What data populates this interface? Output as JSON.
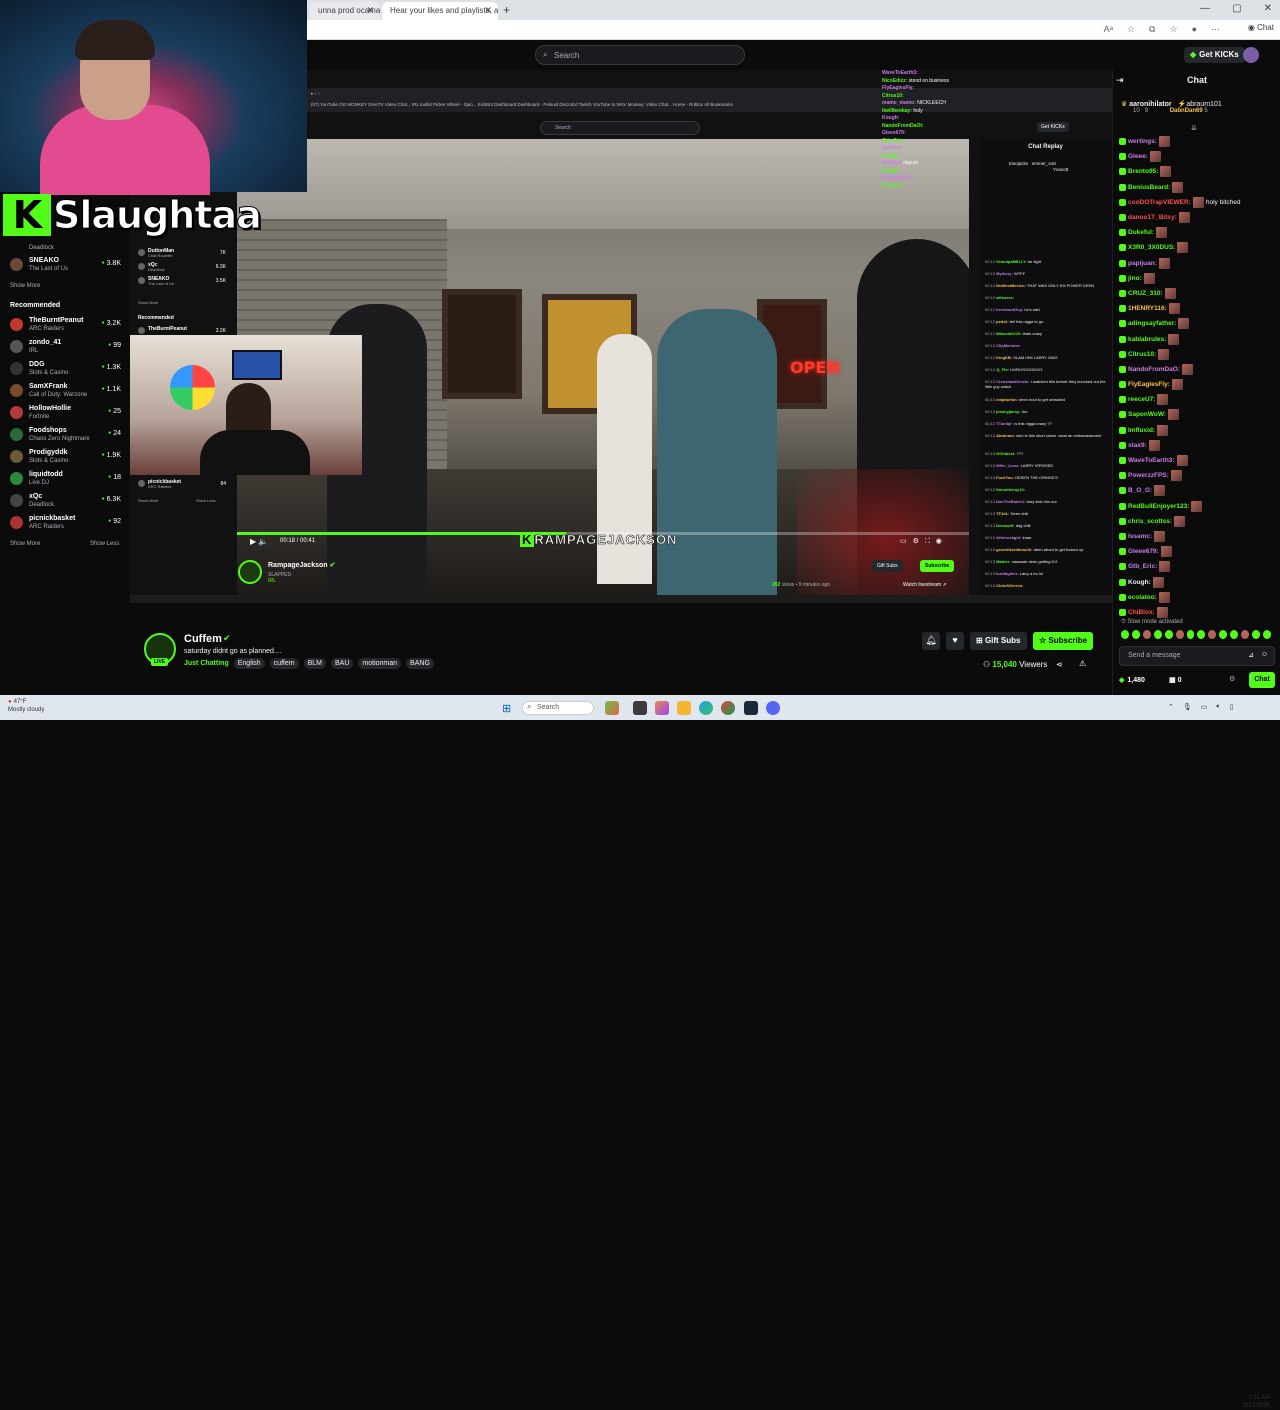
{
  "browser": {
    "tabs": [
      {
        "label": "unna prod ocama.mp",
        "active": false
      },
      {
        "label": "Hear your likes and playlists, and...",
        "active": true
      }
    ],
    "chat_button": "Chat"
  },
  "header": {
    "search_placeholder": "Search",
    "get_kicks": "Get KICKs"
  },
  "streamer_overlay": {
    "name": "Slaughtaa",
    "logo_letter": "K"
  },
  "sidebar": {
    "partial_top": [
      {
        "name": "",
        "category": "Deadlock",
        "viewers": ""
      },
      {
        "name": "SNEAKO",
        "category": "The Last of Us",
        "viewers": "3.8K"
      }
    ],
    "show_more_1": "Show More",
    "recommended_heading": "Recommended",
    "recommended": [
      {
        "name": "TheBurntPeanut",
        "category": "ARC Raiders",
        "viewers": "3.2K"
      },
      {
        "name": "zondo_41",
        "category": "IRL",
        "viewers": "99"
      },
      {
        "name": "DDG",
        "category": "Slots & Casino",
        "viewers": "1.3K"
      },
      {
        "name": "SamXFrank",
        "category": "Call of Duty: Warzone",
        "viewers": "1.1K"
      },
      {
        "name": "HollowHollie",
        "category": "Fortnite",
        "viewers": "25"
      },
      {
        "name": "Foodshops",
        "category": "Chaos Zero Nightmare",
        "viewers": "24"
      },
      {
        "name": "Prodigyddk",
        "category": "Slots & Casino",
        "viewers": "1.9K"
      },
      {
        "name": "liquidtodd",
        "category": "Live DJ",
        "viewers": "18"
      },
      {
        "name": "xQc",
        "category": "Deadlock",
        "viewers": "6.3K"
      },
      {
        "name": "picnickbasket",
        "category": "ARC Raiders",
        "viewers": "92"
      }
    ],
    "show_more_2": "Show More",
    "show_less": "Show Less"
  },
  "nested": {
    "search_placeholder": "Search",
    "get_kicks": "Get KICKs",
    "bookmarks": "(57) YouTube   OG MONKEY   OmeTV Video Chat...   IRL toolkit   Picker Wheel - Spin...   KickBot Dashboard   Dashboard - Pulsoid   DiscroEd   Twitch   YouTube to WAV   Monkey: Video Chat...   Home - Roblox   All Bookmarks",
    "sidebar": [
      {
        "name": "DuttonMan",
        "category": "Chat Roulette",
        "viewers": "7K"
      },
      {
        "name": "xQc",
        "category": "Deadlock",
        "viewers": "6.3K"
      },
      {
        "name": "SNEAKO",
        "category": "The Last of Us",
        "viewers": "3.5K"
      }
    ],
    "sidebar_show_more": "Show More",
    "sidebar_recommended": "Recommended",
    "sidebar_burnt": "TheBurntPeanut",
    "sidebar_burnt_v": "3.2K",
    "sidebar_picnick": "picnickbasket",
    "sidebar_picnick_cat": "ARC Raiders",
    "sidebar_picnick_v": "84",
    "sidebar_show_more_2": "Show More",
    "sidebar_show_less": "Show Less",
    "video": {
      "time": "00:18 / 00:41",
      "progress": 0.45,
      "watermark_k": "K",
      "watermark_text": "RAMPAGEJACKSON",
      "neon_sign": "OPEN"
    },
    "channel": {
      "name": "RampageJackson",
      "title": "SLAPPED",
      "category": "IRL",
      "views": "202",
      "views_suffix": "views • 9 minutes ago",
      "gift_subs": "Gift Subs",
      "subscribe": "Subscribe",
      "watch_livestream": "Watch livestream"
    },
    "chat_replay_title": "Chat Replay",
    "chat_replay_top": [
      {
        "user": "Ewojacks",
        "text": ""
      },
      {
        "user": "emmer_4o8",
        "text": ""
      },
      {
        "user": "Yxariott",
        "text": ""
      }
    ],
    "chat_replay": [
      {
        "time": "00:12",
        "user": "GrandpaMELLY:",
        "text": "he fight"
      },
      {
        "time": "00:12",
        "user": "Myrkery:",
        "text": "WTFF"
      },
      {
        "time": "00:12",
        "user": "NoWestMexico:",
        "text": "THAT WAS ONLY 5% POWER DEEN"
      },
      {
        "time": "00:12",
        "user": "w0wzers:",
        "text": ""
      },
      {
        "time": "00:12",
        "user": "IrrelevantGuy:",
        "text": "he's wild"
      },
      {
        "time": "00:12",
        "user": "pedz2:",
        "text": "tell this nigga to go"
      },
      {
        "time": "00:12",
        "user": "Mikeoth0210:",
        "text": "thats crazy"
      },
      {
        "time": "00:12",
        "user": "ClipMonster:",
        "text": ""
      },
      {
        "time": "00:12",
        "user": "KingKB:",
        "text": "SLAM HIM LARRY OMG"
      },
      {
        "time": "00:12",
        "user": "Jj_Flo:",
        "text": "LMFAOOOOOOO"
      },
      {
        "time": "00:13",
        "user": "CrenshawKenzie:",
        "text": "I watched this before they knocked out the little guy watch"
      },
      {
        "time": "00:13",
        "user": "ninjaturkin:",
        "text": "deen bout to get smacked"
      },
      {
        "time": "00:13",
        "user": "jeannyjanny:",
        "text": "bro"
      },
      {
        "time": "00:13",
        "user": "TTumbjr:",
        "text": "is this nigga crazy ??"
      },
      {
        "time": "00:13",
        "user": "Abrahum:",
        "text": "who is this short clown. what an embarrassment"
      },
      {
        "time": "00:13",
        "user": "GGhlbest:",
        "text": "???"
      },
      {
        "time": "00:13",
        "user": "Wilie_Lionz:",
        "text": "LARRY ISPISSED"
      },
      {
        "time": "00:13",
        "user": "FuckYou:",
        "text": "DEEEN THE CRINGE!!!"
      },
      {
        "time": "00:13",
        "user": "Smootheray10:",
        "text": ""
      },
      {
        "time": "00:13",
        "user": "DanTheBaker1:",
        "text": "larry kick him out"
      },
      {
        "time": "00:13",
        "user": "TFJdL:",
        "text": "Deen chill"
      },
      {
        "time": "00:13",
        "user": "Demsor9:",
        "text": "ddg chill"
      },
      {
        "time": "00:13",
        "user": "Afterrockgirl:",
        "text": "lmao"
      },
      {
        "time": "00:13",
        "user": "geostrikerdimaz10:",
        "text": "deen about to get fucked up"
      },
      {
        "time": "00:13",
        "user": "Marker:",
        "text": "naaaaah deen getting KO"
      },
      {
        "time": "00:13",
        "user": "kurtdighter:",
        "text": "Larry a ho lol"
      },
      {
        "time": "00:13",
        "user": "ChrisSGerreo:",
        "text": ""
      },
      {
        "time": "00:14",
        "user": "JenaJitsuBelt:",
        "text": ""
      }
    ],
    "overlay_chat": [
      {
        "user": "",
        "text": ""
      },
      {
        "user": "",
        "text": ""
      },
      {
        "user": "WaveToEarth3:",
        "text": ""
      },
      {
        "user": "NicoEdizz:",
        "text": "stood on business"
      },
      {
        "user": "FlyEaglesFly:",
        "text": ""
      },
      {
        "user": "Citrus10:",
        "text": ""
      },
      {
        "user": "mamo_mamo:",
        "text": "NICKLEECH"
      },
      {
        "user": "itwillbeokay:",
        "text": "holy"
      },
      {
        "user": "Kough:",
        "text": ""
      },
      {
        "user": "NandoFromDaOt:",
        "text": ""
      },
      {
        "user": "Gleee679:",
        "text": ""
      },
      {
        "user": "Gtb_Eric:",
        "text": ""
      },
      {
        "user": "jayGrizz:",
        "text": ""
      },
      {
        "user": "Kough:",
        "text": ""
      },
      {
        "user": "Eto0AU:",
        "text": "dayum"
      },
      {
        "user": "Kough:",
        "text": ""
      },
      {
        "user": "FlyEaglesFly:",
        "text": ""
      },
      {
        "user": "Citrus10:",
        "text": ""
      }
    ]
  },
  "chat": {
    "title": "Chat",
    "pinned_user1": "aaronihilator",
    "pinned_count1": "10",
    "pinned_user2": "abraum101",
    "pinned_count2": "9",
    "pinned_user3": "DabnDan69",
    "pinned_count3": "5",
    "messages": [
      {
        "user": "wertings:",
        "text": "",
        "color": "#c97ee6"
      },
      {
        "user": "Gleee:",
        "text": "",
        "color": "#c97ee6"
      },
      {
        "user": "Brento95:",
        "text": "",
        "color": "#53fc18"
      },
      {
        "user": "BeniusBeard:",
        "text": "",
        "color": "#53fc18"
      },
      {
        "user": "cooDOTrapVIEWER:",
        "text": "holy bitched",
        "color": "#ff4d4d"
      },
      {
        "user": "danoo1T_Bitsy:",
        "text": "",
        "color": "#ff4d4d"
      },
      {
        "user": "Dukeful:",
        "text": "",
        "color": "#53fc18"
      },
      {
        "user": "X3R0_3X0DUS:",
        "text": "",
        "color": "#53fc18"
      },
      {
        "user": "papijuan:",
        "text": "",
        "color": "#c97ee6"
      },
      {
        "user": "jino:",
        "text": "",
        "color": "#53fc18"
      },
      {
        "user": "CRUZ_310:",
        "text": "",
        "color": "#53fc18"
      },
      {
        "user": "1HENRY116:",
        "text": "",
        "color": "#f6c244"
      },
      {
        "user": "adingsayfather:",
        "text": "",
        "color": "#53fc18"
      },
      {
        "user": "kablabrules:",
        "text": "",
        "color": "#53fc18"
      },
      {
        "user": "Citrus10:",
        "text": "",
        "color": "#53fc18"
      },
      {
        "user": "NandoFromDaO:",
        "text": "",
        "color": "#c97ee6"
      },
      {
        "user": "FlyEaglesFly:",
        "text": "",
        "color": "#f6c244"
      },
      {
        "user": "reeceU7:",
        "text": "",
        "color": "#53fc18"
      },
      {
        "user": "SaponWoW:",
        "text": "",
        "color": "#53fc18"
      },
      {
        "user": "Imfluxid:",
        "text": "",
        "color": "#53fc18"
      },
      {
        "user": "stax9:",
        "text": "",
        "color": "#c97ee6"
      },
      {
        "user": "WaveToEarth3:",
        "text": "",
        "color": "#c97ee6"
      },
      {
        "user": "PowerzzFPS:",
        "text": "",
        "color": "#c97ee6"
      },
      {
        "user": "B_O_G:",
        "text": "",
        "color": "#c97ee6"
      },
      {
        "user": "RedBullEnjoyer123:",
        "text": "",
        "color": "#53fc18"
      },
      {
        "user": "chris_scottss:",
        "text": "",
        "color": "#53fc18"
      },
      {
        "user": "Issamc:",
        "text": "",
        "color": "#c97ee6"
      },
      {
        "user": "Gleee679:",
        "text": "",
        "color": "#c97ee6"
      },
      {
        "user": "Gtb_Eric:",
        "text": "",
        "color": "#c97ee6"
      },
      {
        "user": "Kough:",
        "text": "",
        "color": "#efeff1"
      },
      {
        "user": "ecolatoo:",
        "text": "",
        "color": "#53fc18"
      },
      {
        "user": "ChiBlox:",
        "text": "",
        "color": "#ff4d4d"
      }
    ],
    "slow_mode": "Slow mode activated",
    "input_placeholder": "Send a message",
    "kicks_count": "1,480",
    "points": "0",
    "send_label": "Chat"
  },
  "channel": {
    "name": "Cuffem",
    "title": "saturday didnt go as planned....",
    "category": "Just Chatting",
    "live_label": "LIVE",
    "tags": [
      "English",
      "cuffem",
      "BLM",
      "BAU",
      "motionman",
      "BANG"
    ],
    "gift_subs": "Gift Subs",
    "subscribe": "Subscribe",
    "viewers_count": "15,040",
    "viewers_label": "Viewers"
  },
  "taskbar": {
    "weather_temp": "47°F",
    "weather_desc": "Mostly cloudy",
    "search": "Search",
    "time": "1:11 AM",
    "date": "2/17/2026"
  },
  "colors": {
    "kick_green": "#53fc18",
    "background": "#0b0b0c",
    "panel": "#24272c"
  }
}
